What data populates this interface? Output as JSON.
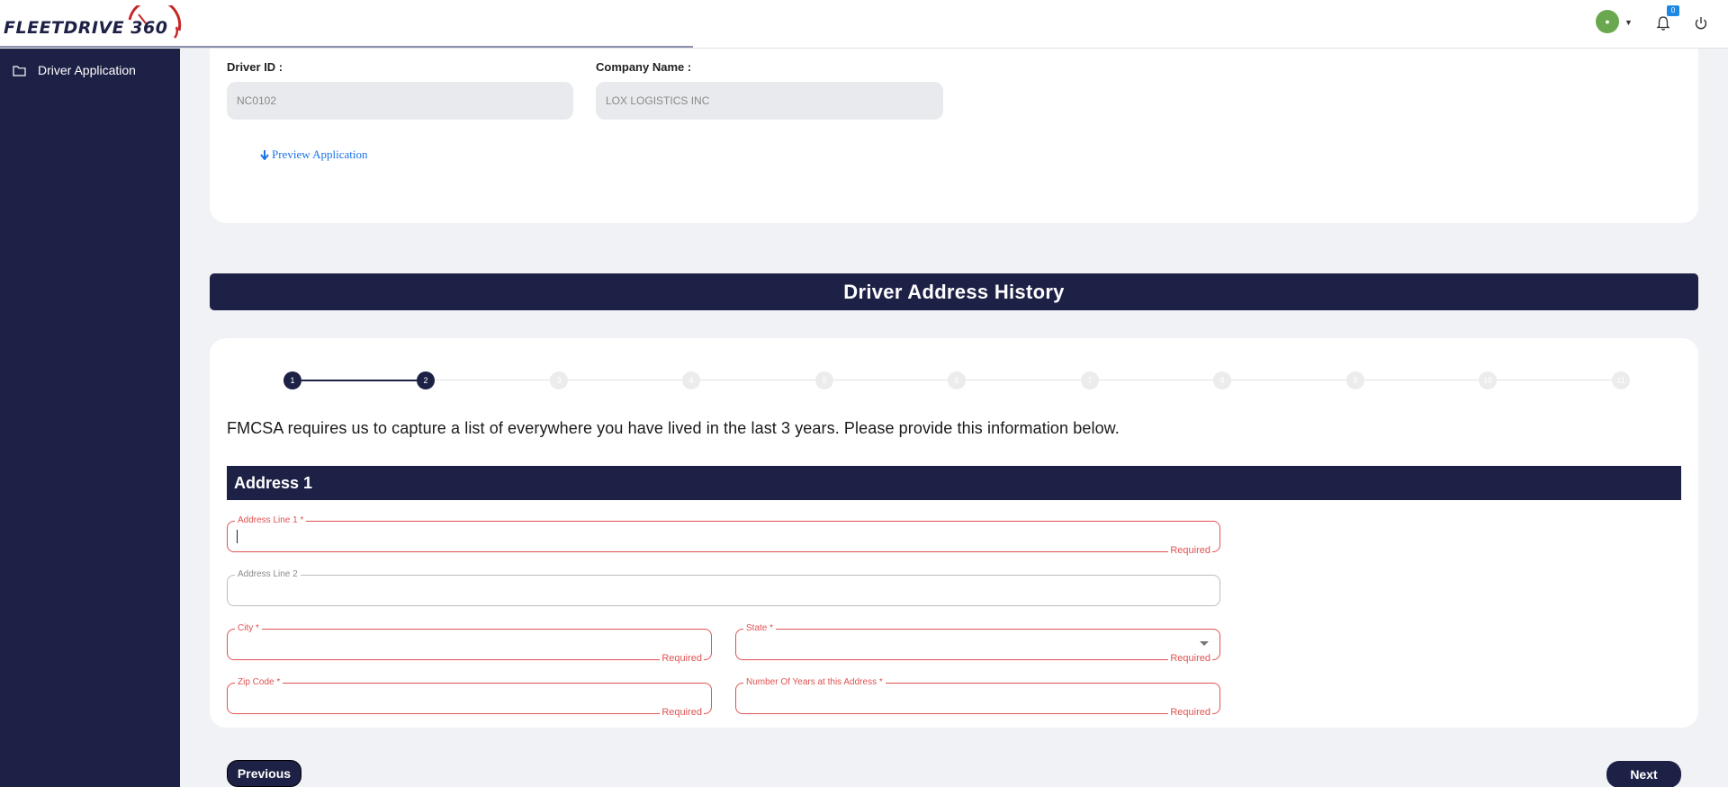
{
  "header": {
    "logo_text": "FLEETDRIVE",
    "logo_number": "360",
    "avatar_symbol": "●",
    "notifications_count": "0"
  },
  "sidebar": {
    "items": [
      {
        "label": "Driver Application",
        "icon": "folder-icon"
      }
    ]
  },
  "info": {
    "driver_id_label": "Driver ID :",
    "driver_id_value": "NC0102",
    "company_name_label": "Company Name :",
    "company_name_value": "LOX LOGISTICS INC",
    "preview_link": "Preview Application"
  },
  "section_title": "Driver Address History",
  "stepper": {
    "steps": [
      "1",
      "2",
      "3",
      "4",
      "5",
      "6",
      "7",
      "8",
      "9",
      "10",
      "11"
    ],
    "current_step": 2
  },
  "intro_text": "FMCSA requires us to capture a list of everywhere you have lived in the last 3 years. Please provide this information below.",
  "address_block": {
    "title": "Address 1",
    "fields": {
      "address_line_1": {
        "label": "Address Line 1 *",
        "value": "",
        "error": "Required"
      },
      "address_line_2": {
        "label": "Address Line 2",
        "value": ""
      },
      "city": {
        "label": "City *",
        "value": "",
        "error": "Required"
      },
      "state": {
        "label": "State *",
        "value": "",
        "error": "Required"
      },
      "zip_code": {
        "label": "Zip Code *",
        "value": "",
        "error": "Required"
      },
      "years_at_address": {
        "label": "Number Of Years at this Address *",
        "value": "",
        "error": "Required"
      }
    }
  },
  "navigation": {
    "previous_label": "Previous",
    "next_label": "Next"
  },
  "colors": {
    "primary": "#1e2146",
    "error": "#e05252",
    "link": "#1a73e8",
    "background": "#f0f2f5"
  }
}
